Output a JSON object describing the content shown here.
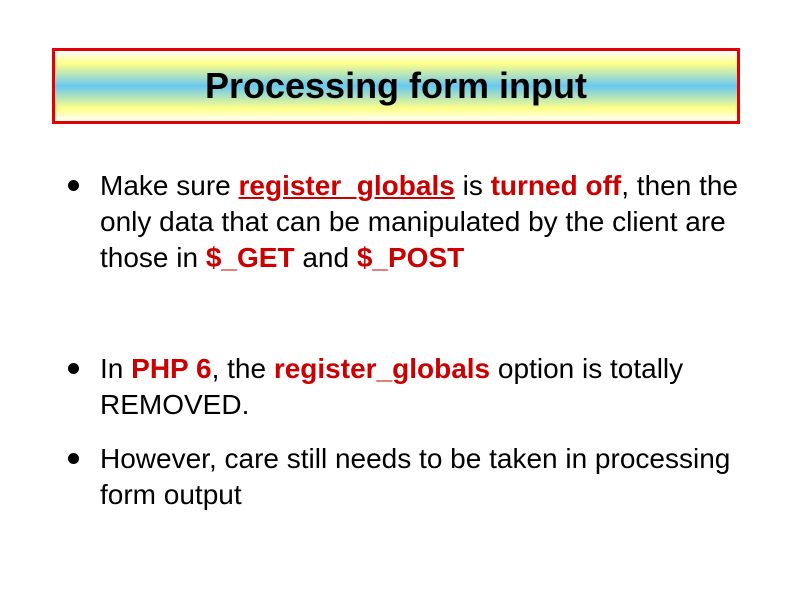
{
  "title": "Processing form input",
  "bullets": {
    "b1": {
      "p0": "Make sure ",
      "p1": "register_globals",
      "p2": " is ",
      "p3": "turned off",
      "p4": ", then the only data that can be manipulated by the client are those in ",
      "p5": "$_GET",
      "p6": " and ",
      "p7": "$_POST"
    },
    "b2": {
      "p0": "In ",
      "p1": "PHP 6",
      "p2": ", the ",
      "p3": "register_globals",
      "p4": " option is totally REMOVED."
    },
    "b3": {
      "p0": "However, care still needs to be taken in processing form output"
    }
  }
}
